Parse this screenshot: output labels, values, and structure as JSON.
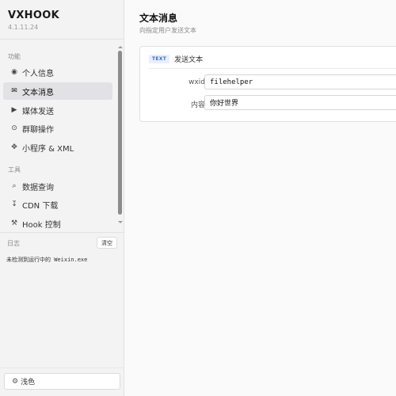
{
  "brand": {
    "title": "VXHOOK",
    "version": "4.1.11.24"
  },
  "sidebar": {
    "sections": [
      {
        "label": "功能"
      },
      {
        "label": "工具"
      }
    ],
    "items": [
      {
        "label": "个人信息",
        "icon": "user-circle-icon",
        "active": false
      },
      {
        "label": "文本消息",
        "icon": "envelope-icon",
        "active": true
      },
      {
        "label": "媒体发送",
        "icon": "play-icon",
        "active": false
      },
      {
        "label": "群聊操作",
        "icon": "group-icon",
        "active": false
      },
      {
        "label": "小程序 & XML",
        "icon": "puzzle-icon",
        "active": false
      },
      {
        "label": "数据查询",
        "icon": "search-icon",
        "active": false
      },
      {
        "label": "CDN 下载",
        "icon": "download-icon",
        "active": false
      },
      {
        "label": "Hook 控制",
        "icon": "tools-icon",
        "active": false
      }
    ]
  },
  "log": {
    "label": "日志",
    "clear_label": "清空",
    "lines": [
      {
        "prefix": "未检测到运行中的",
        "process": " Weixin.exe"
      }
    ]
  },
  "theme": {
    "label": "浅色",
    "icon": "gear-icon"
  },
  "main": {
    "title": "文本消息",
    "subtitle": "向指定用户发送文本",
    "card": {
      "badge": "TEXT",
      "title": "发送文本",
      "fields": [
        {
          "label": "wxid",
          "value": "filehelper",
          "mono": true
        },
        {
          "label": "内容",
          "value": "你好世界",
          "mono": false
        }
      ]
    }
  },
  "colors": {
    "sidebar_bg": "#f3f3f3",
    "active_item_bg": "#e2e2e6",
    "badge_text": "#3c6fd1",
    "badge_bg": "#e9effb",
    "main_bg": "#fafafa"
  }
}
